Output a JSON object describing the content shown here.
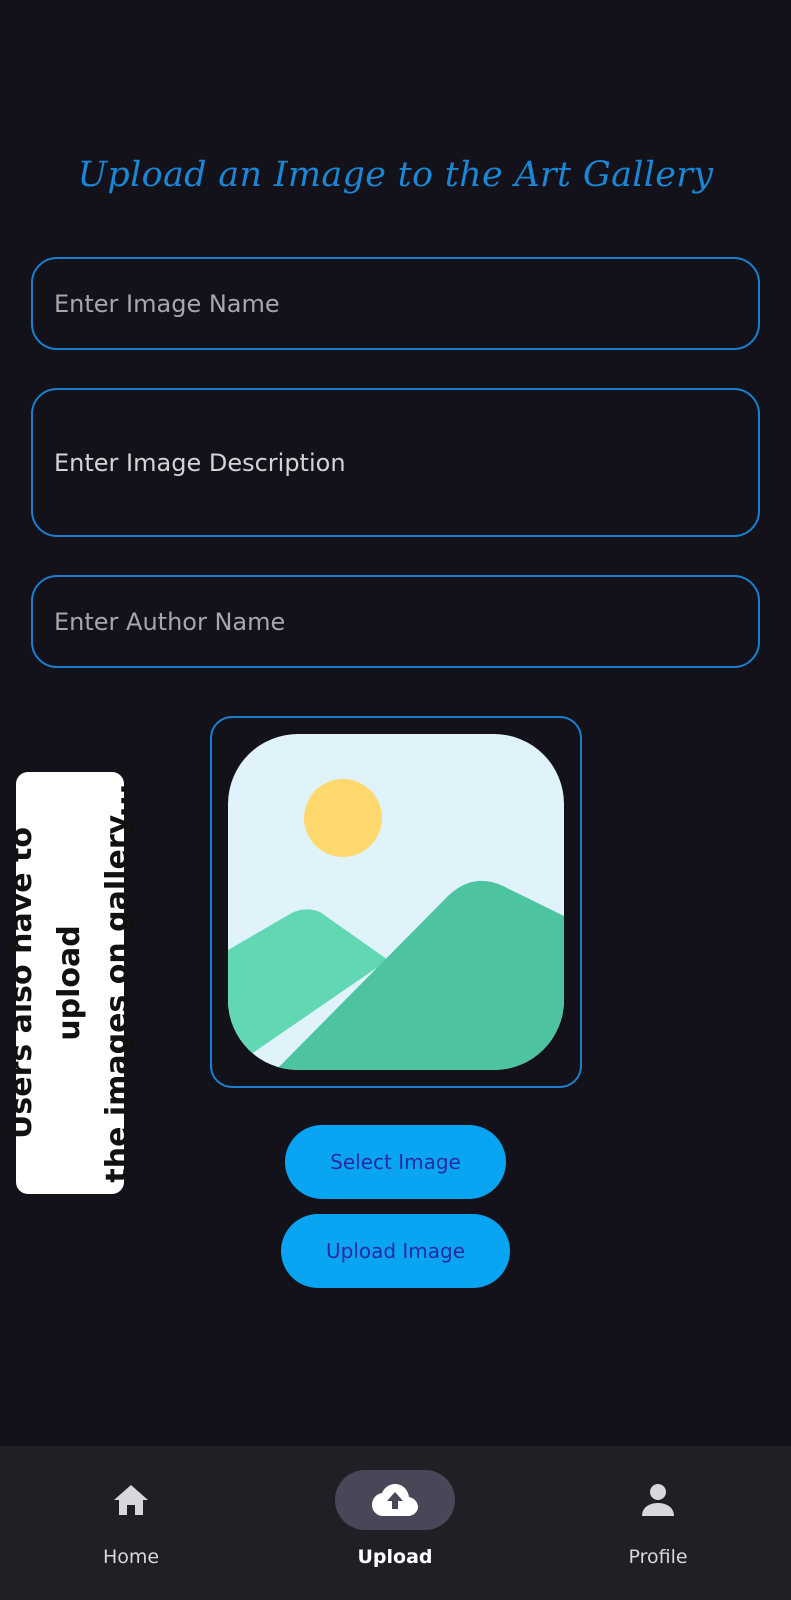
{
  "page": {
    "title": "Upload an Image to the Art Gallery"
  },
  "form": {
    "image_name_placeholder": "Enter Image Name",
    "image_description_placeholder": "Enter Image Description",
    "author_name_placeholder": "Enter Author Name"
  },
  "preview": {
    "icon": "image-placeholder-icon"
  },
  "buttons": {
    "select_image": "Select Image",
    "upload_image": "Upload Image"
  },
  "overlay": {
    "note": "Users also have to upload\nthe images on gallery..."
  },
  "nav": {
    "items": [
      {
        "label": "Home",
        "icon": "home-icon",
        "active": false
      },
      {
        "label": "Upload",
        "icon": "cloud-upload-icon",
        "active": true
      },
      {
        "label": "Profile",
        "icon": "person-icon",
        "active": false
      }
    ]
  },
  "colors": {
    "background": "#13121a",
    "accent": "#1b86d4",
    "button": "#09a5f3",
    "button_text": "#2a2aa0",
    "nav_background": "#1f1f26",
    "nav_active_pill": "#4a4657"
  }
}
